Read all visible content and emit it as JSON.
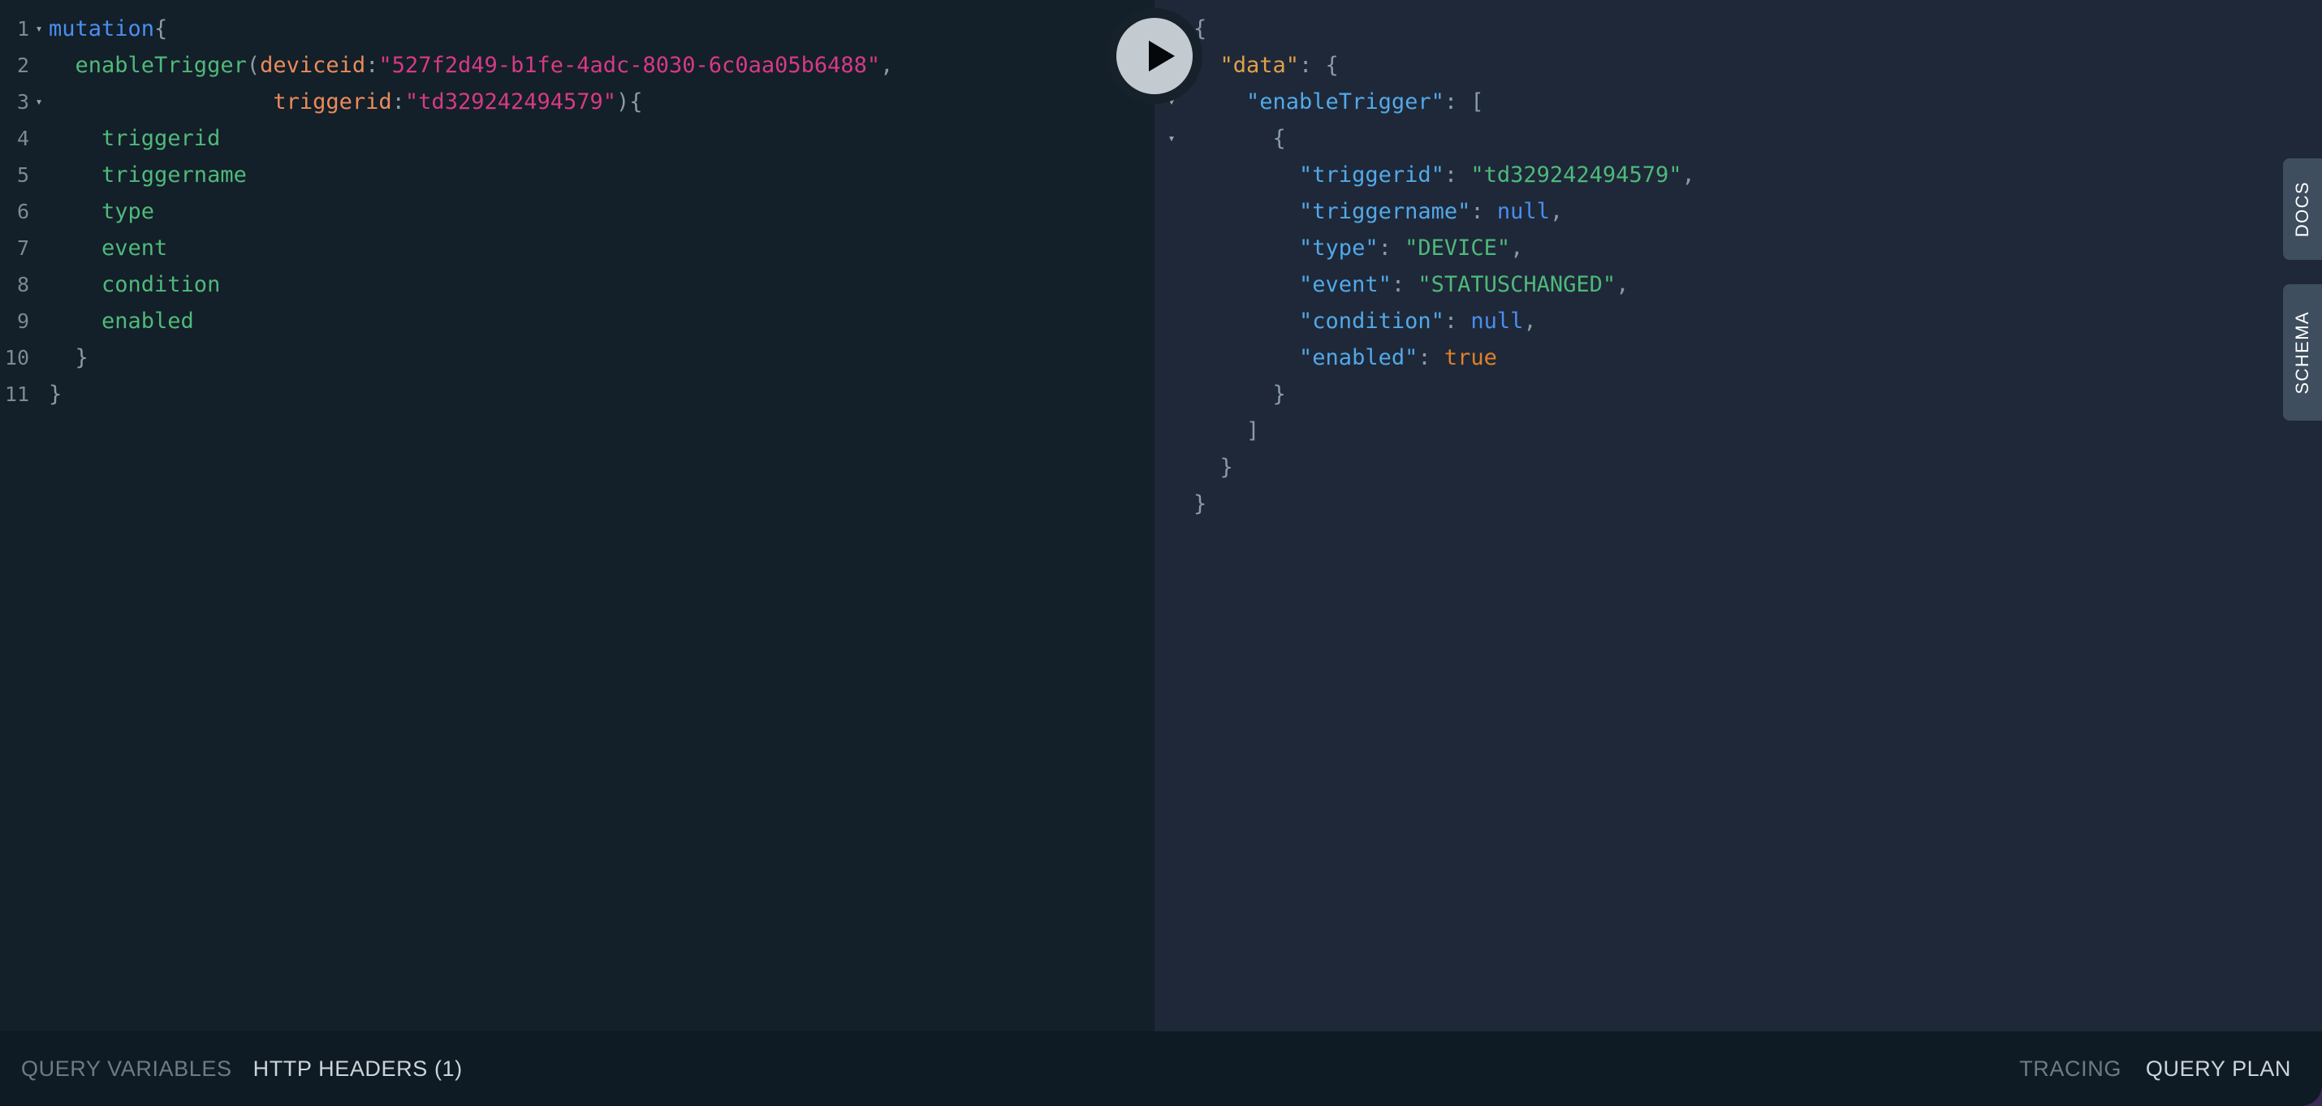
{
  "app": {
    "name": "graphql-playground",
    "colors": {
      "editor_background": "#131f29",
      "result_background": "#1e2838",
      "bottom_bar_background": "#0f1b24",
      "side_tab_background": "#3e4e5e",
      "accent_purple": "#3b2a5a",
      "execute_button": "#c3cbd1"
    }
  },
  "execute_button": {
    "label": "play-button",
    "title": "Execute Query"
  },
  "side_tabs": [
    {
      "id": "docs",
      "label": "DOCS"
    },
    {
      "id": "schema",
      "label": "SCHEMA"
    }
  ],
  "editor": {
    "language": "graphql",
    "lines": [
      {
        "number": "1",
        "fold": "▾",
        "tokens": [
          {
            "text": "mutation",
            "cls": "t-kw"
          },
          {
            "text": "{",
            "cls": "t-punct"
          }
        ]
      },
      {
        "number": "2",
        "fold": "",
        "tokens": [
          {
            "text": "  enableTrigger",
            "cls": "t-field"
          },
          {
            "text": "(",
            "cls": "t-punct"
          },
          {
            "text": "deviceid",
            "cls": "t-arg"
          },
          {
            "text": ":",
            "cls": "t-punct"
          },
          {
            "text": "\"527f2d49-b1fe-4adc-8030-6c0aa05b6488\"",
            "cls": "t-str"
          },
          {
            "text": ",",
            "cls": "t-punct"
          }
        ]
      },
      {
        "number": "3",
        "fold": "▾",
        "tokens": [
          {
            "text": "                 ",
            "cls": "t-punct"
          },
          {
            "text": "triggerid",
            "cls": "t-arg"
          },
          {
            "text": ":",
            "cls": "t-punct"
          },
          {
            "text": "\"td329242494579\"",
            "cls": "t-str"
          },
          {
            "text": "){",
            "cls": "t-punct"
          }
        ]
      },
      {
        "number": "4",
        "fold": "",
        "tokens": [
          {
            "text": "    triggerid",
            "cls": "t-field"
          }
        ]
      },
      {
        "number": "5",
        "fold": "",
        "tokens": [
          {
            "text": "    triggername",
            "cls": "t-field"
          }
        ]
      },
      {
        "number": "6",
        "fold": "",
        "tokens": [
          {
            "text": "    type",
            "cls": "t-field"
          }
        ]
      },
      {
        "number": "7",
        "fold": "",
        "tokens": [
          {
            "text": "    event",
            "cls": "t-field"
          }
        ]
      },
      {
        "number": "8",
        "fold": "",
        "tokens": [
          {
            "text": "    condition",
            "cls": "t-field"
          }
        ]
      },
      {
        "number": "9",
        "fold": "",
        "tokens": [
          {
            "text": "    enabled",
            "cls": "t-field"
          }
        ]
      },
      {
        "number": "10",
        "fold": "",
        "tokens": [
          {
            "text": "  }",
            "cls": "t-punct"
          }
        ]
      },
      {
        "number": "11",
        "fold": "",
        "tokens": [
          {
            "text": "}",
            "cls": "t-punct"
          }
        ]
      }
    ]
  },
  "result": {
    "lines": [
      {
        "fold": "▾",
        "tokens": [
          {
            "text": "{",
            "cls": "j-punct"
          }
        ]
      },
      {
        "fold": "▾",
        "tokens": [
          {
            "text": "  \"data\"",
            "cls": "j-data"
          },
          {
            "text": ": {",
            "cls": "j-punct"
          }
        ]
      },
      {
        "fold": "▾",
        "tokens": [
          {
            "text": "    \"enableTrigger\"",
            "cls": "j-key"
          },
          {
            "text": ": [",
            "cls": "j-punct"
          }
        ]
      },
      {
        "fold": "▾",
        "tokens": [
          {
            "text": "      {",
            "cls": "j-punct"
          }
        ]
      },
      {
        "fold": "",
        "tokens": [
          {
            "text": "        \"triggerid\"",
            "cls": "j-key"
          },
          {
            "text": ": ",
            "cls": "j-punct"
          },
          {
            "text": "\"td329242494579\"",
            "cls": "j-str"
          },
          {
            "text": ",",
            "cls": "j-punct"
          }
        ]
      },
      {
        "fold": "",
        "tokens": [
          {
            "text": "        \"triggername\"",
            "cls": "j-key"
          },
          {
            "text": ": ",
            "cls": "j-punct"
          },
          {
            "text": "null",
            "cls": "j-null"
          },
          {
            "text": ",",
            "cls": "j-punct"
          }
        ]
      },
      {
        "fold": "",
        "tokens": [
          {
            "text": "        \"type\"",
            "cls": "j-key"
          },
          {
            "text": ": ",
            "cls": "j-punct"
          },
          {
            "text": "\"DEVICE\"",
            "cls": "j-str"
          },
          {
            "text": ",",
            "cls": "j-punct"
          }
        ]
      },
      {
        "fold": "",
        "tokens": [
          {
            "text": "        \"event\"",
            "cls": "j-key"
          },
          {
            "text": ": ",
            "cls": "j-punct"
          },
          {
            "text": "\"STATUSCHANGED\"",
            "cls": "j-str"
          },
          {
            "text": ",",
            "cls": "j-punct"
          }
        ]
      },
      {
        "fold": "",
        "tokens": [
          {
            "text": "        \"condition\"",
            "cls": "j-key"
          },
          {
            "text": ": ",
            "cls": "j-punct"
          },
          {
            "text": "null",
            "cls": "j-null"
          },
          {
            "text": ",",
            "cls": "j-punct"
          }
        ]
      },
      {
        "fold": "",
        "tokens": [
          {
            "text": "        \"enabled\"",
            "cls": "j-key"
          },
          {
            "text": ": ",
            "cls": "j-punct"
          },
          {
            "text": "true",
            "cls": "j-bool"
          }
        ]
      },
      {
        "fold": "",
        "tokens": [
          {
            "text": "      }",
            "cls": "j-punct"
          }
        ]
      },
      {
        "fold": "",
        "tokens": [
          {
            "text": "    ]",
            "cls": "j-punct"
          }
        ]
      },
      {
        "fold": "",
        "tokens": [
          {
            "text": "  }",
            "cls": "j-punct"
          }
        ]
      },
      {
        "fold": "",
        "tokens": [
          {
            "text": "}",
            "cls": "j-punct"
          }
        ]
      }
    ]
  },
  "bottom_bar": {
    "left_tabs": [
      {
        "id": "query-variables",
        "label": "QUERY VARIABLES",
        "active": false
      },
      {
        "id": "http-headers",
        "label": "HTTP HEADERS (1)",
        "active": true
      }
    ],
    "right_tabs": [
      {
        "id": "tracing",
        "label": "TRACING",
        "active": false
      },
      {
        "id": "query-plan",
        "label": "QUERY PLAN",
        "active": true
      }
    ]
  }
}
